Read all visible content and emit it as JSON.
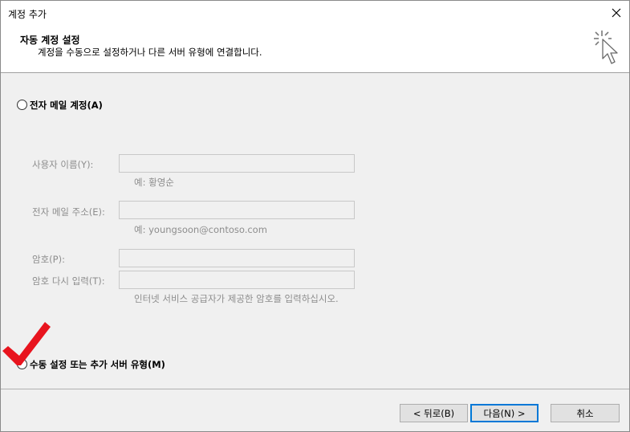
{
  "window": {
    "title": "계정 추가",
    "close_icon": "close-icon"
  },
  "header": {
    "title": "자동 계정 설정",
    "subtitle": "계정을 수동으로 설정하거나 다른 서버 유형에 연결합니다.",
    "icon": "wizard-cursor-icon"
  },
  "email_account": {
    "label": "전자 메일 계정(A)",
    "selected": false,
    "fields": {
      "name_label": "사용자 이름(Y):",
      "name_value": "",
      "name_hint": "예: 황영순",
      "email_label": "전자 메일 주소(E):",
      "email_value": "",
      "email_hint": "예: youngsoon@contoso.com",
      "password_label": "암호(P):",
      "password_value": "",
      "confirm_label": "암호 다시 입력(T):",
      "confirm_value": "",
      "password_hint": "인터넷 서비스 공급자가 제공한 암호를 입력하십시오."
    }
  },
  "manual_setup": {
    "label": "수동 설정 또는 추가 서버 유형(M)",
    "selected": true,
    "annotation": "red-checkmark-icon"
  },
  "buttons": {
    "back": "< 뒤로(B)",
    "next": "다음(N) >",
    "cancel": "취소"
  },
  "colors": {
    "accent": "#0078d7",
    "annotation": "#e8141e",
    "disabled_text": "#8d8d8d"
  }
}
